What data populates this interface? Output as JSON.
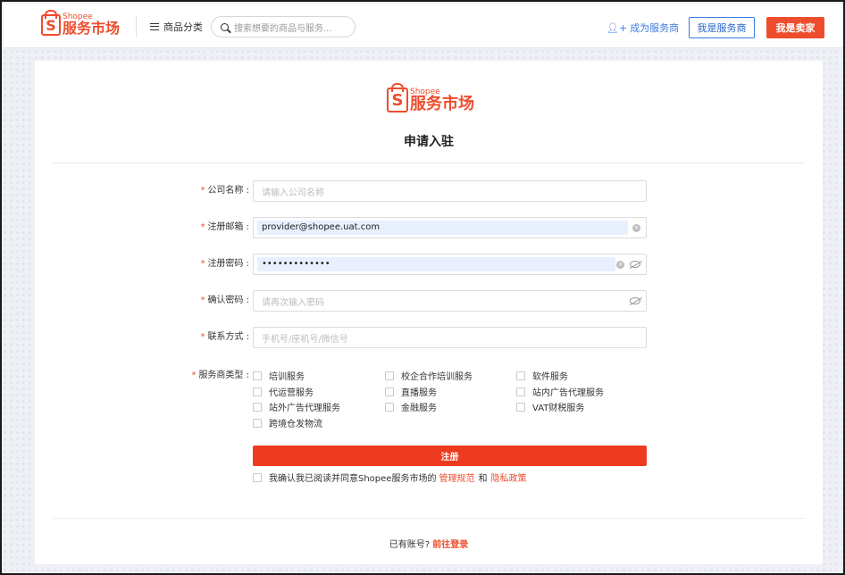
{
  "header": {
    "logo_brand": "Shopee",
    "logo_name": "服务市场",
    "logo_bag_letter": "S",
    "category_label": "商品分类",
    "search_placeholder": "搜索想要的商品与服务...",
    "become_provider": "成为服务商",
    "provider_button": "我是服务商",
    "seller_button": "我是卖家"
  },
  "card": {
    "logo_brand": "Shopee",
    "logo_name": "服务市场",
    "logo_bag_letter": "S",
    "title": "申请入驻"
  },
  "form": {
    "required_mark": "*",
    "company": {
      "label": "公司名称 :",
      "placeholder": "请输入公司名称",
      "value": ""
    },
    "email": {
      "label": "注册邮箱 :",
      "value": "provider@shopee.uat.com"
    },
    "password": {
      "label": "注册密码 :",
      "value": "•••••••••••••"
    },
    "confirm": {
      "label": "确认密码 :",
      "placeholder": "请再次输入密码",
      "value": ""
    },
    "contact": {
      "label": "联系方式 :",
      "placeholder": "手机号/座机号/微信号",
      "value": ""
    },
    "types_label": "服务商类型 :",
    "service_types": [
      {
        "label": "培训服务",
        "checked": false
      },
      {
        "label": "校企合作培训服务",
        "checked": false
      },
      {
        "label": "软件服务",
        "checked": false
      },
      {
        "label": "代运营服务",
        "checked": false
      },
      {
        "label": "直播服务",
        "checked": false
      },
      {
        "label": "站内广告代理服务",
        "checked": false
      },
      {
        "label": "站外广告代理服务",
        "checked": false
      },
      {
        "label": "金融服务",
        "checked": false
      },
      {
        "label": "VAT财税服务",
        "checked": false
      },
      {
        "label": "跨境仓发物流",
        "checked": false
      }
    ],
    "submit_label": "注册",
    "agree_prefix": "我确认我已阅读并同意Shopee服务市场的",
    "agree_link1": "管理规范",
    "agree_and": "和",
    "agree_link2": "隐私政策"
  },
  "footer": {
    "login_prefix": "已有账号?",
    "login_link": "前往登录"
  },
  "colors": {
    "brand": "#ee4d2d",
    "link_blue": "#3a7ce0",
    "autofill": "#e8f0fe"
  },
  "icons": [
    "shopee-bag-icon",
    "menu-list-icon",
    "search-icon",
    "add-person-icon",
    "clear-icon",
    "eye-hidden-icon",
    "checkbox-icon"
  ]
}
